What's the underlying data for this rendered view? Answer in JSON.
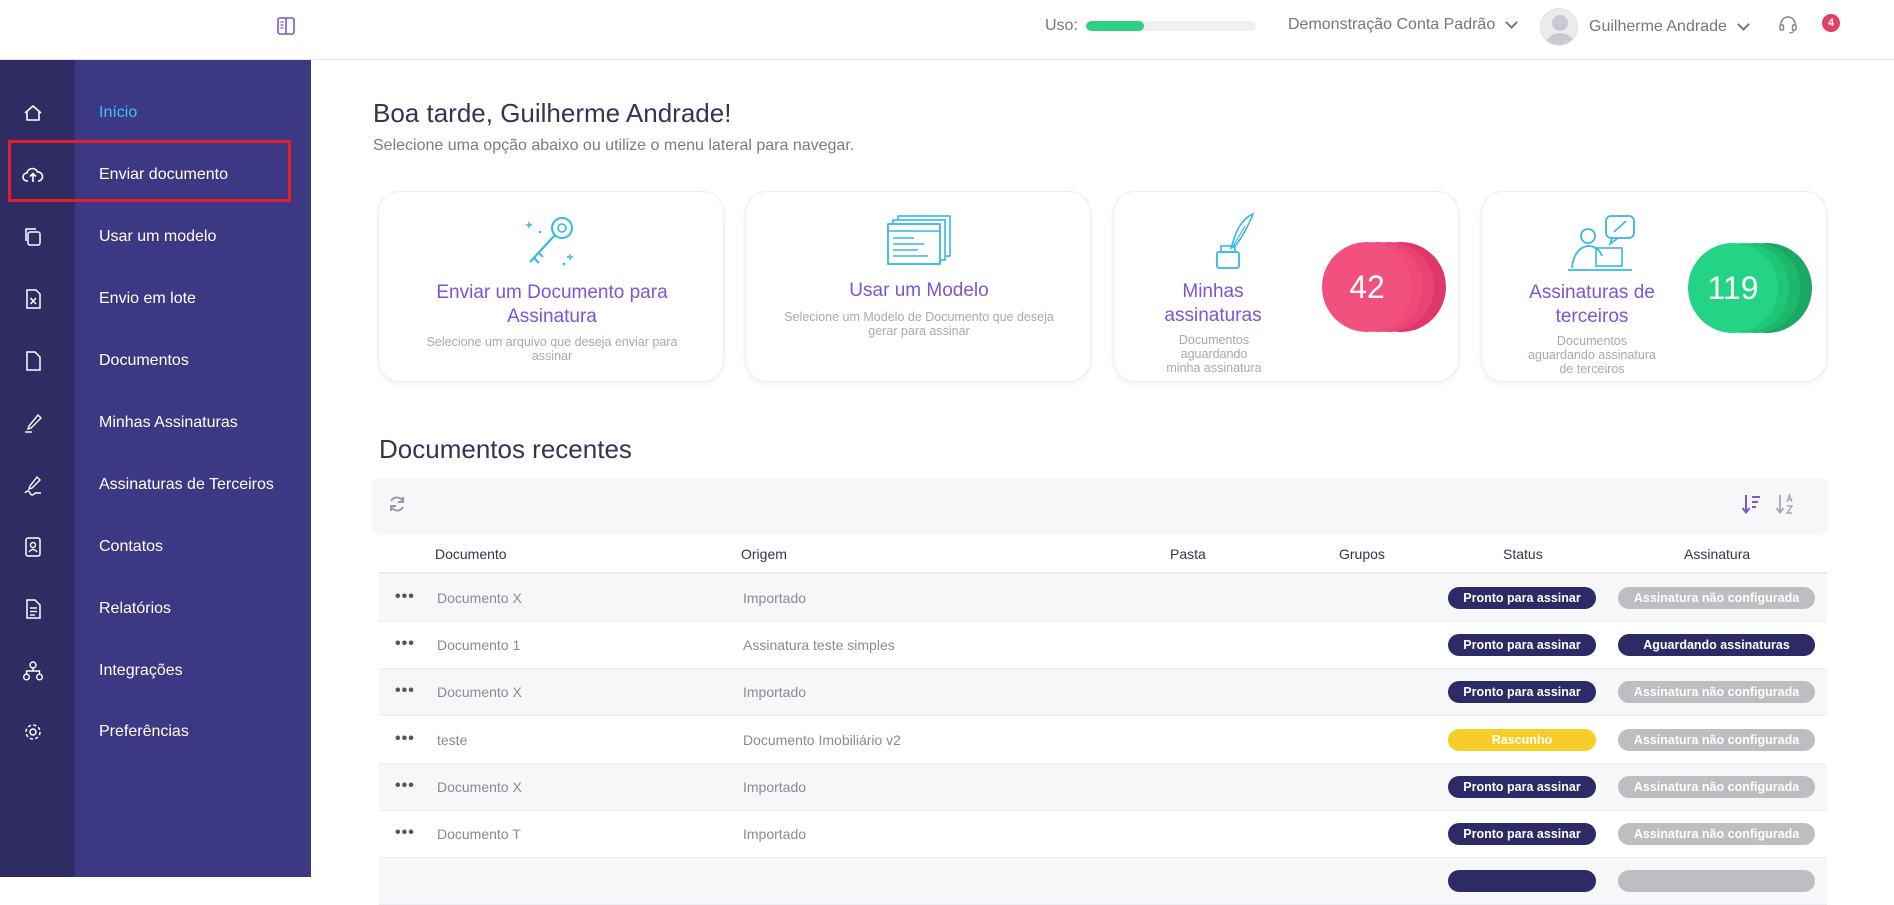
{
  "header": {
    "usage_label": "Uso:",
    "usage_fraction": 0.34,
    "account_name": "Demonstração Conta Padrão",
    "user_name": "Guilherme Andrade",
    "notification_count": "4"
  },
  "sidebar": {
    "items": [
      {
        "label": "Início",
        "icon": "home-icon",
        "active": true
      },
      {
        "label": "Enviar documento",
        "icon": "cloud-upload-icon",
        "active": false
      },
      {
        "label": "Usar um modelo",
        "icon": "template-icon",
        "active": false
      },
      {
        "label": "Envio em lote",
        "icon": "spreadsheet-icon",
        "active": false
      },
      {
        "label": "Documentos",
        "icon": "document-icon",
        "active": false
      },
      {
        "label": "Minhas Assinaturas",
        "icon": "pen-icon",
        "active": false
      },
      {
        "label": "Assinaturas de Terceiros",
        "icon": "signature-icon",
        "active": false
      },
      {
        "label": "Contatos",
        "icon": "contact-icon",
        "active": false
      },
      {
        "label": "Relatórios",
        "icon": "report-icon",
        "active": false
      },
      {
        "label": "Integrações",
        "icon": "integration-icon",
        "active": false
      },
      {
        "label": "Preferências",
        "icon": "gear-icon",
        "active": false
      }
    ]
  },
  "main": {
    "greeting": "Boa tarde, Guilherme Andrade!",
    "subtitle": "Selecione uma opção abaixo ou utilize o menu lateral para navegar."
  },
  "cards": [
    {
      "title": "Enviar um Documento para Assinatura",
      "desc": "Selecione um arquivo que deseja enviar para assinar"
    },
    {
      "title": "Usar um Modelo",
      "desc": "Selecione um Modelo de Documento que deseja gerar para assinar"
    },
    {
      "title": "Minhas assinaturas",
      "desc": "Documentos aguardando minha assinatura",
      "count": "42"
    },
    {
      "title": "Assinaturas de terceiros",
      "desc": "Documentos aguardando assinatura de terceiros",
      "count": "119"
    }
  ],
  "recent": {
    "title": "Documentos recentes",
    "columns": [
      "Documento",
      "Origem",
      "Pasta",
      "Grupos",
      "Status",
      "Assinatura"
    ],
    "rows": [
      {
        "doc": "Documento X",
        "origin": "Importado",
        "status": "Pronto para assinar",
        "sign": "Assinatura não configurada"
      },
      {
        "doc": "Documento 1",
        "origin": "Assinatura teste simples",
        "status": "Pronto para assinar",
        "sign": "Aguardando assinaturas"
      },
      {
        "doc": "Documento X",
        "origin": "Importado",
        "status": "Pronto para assinar",
        "sign": "Assinatura não configurada"
      },
      {
        "doc": "teste",
        "origin": "Documento Imobiliário v2",
        "status": "Rascunho",
        "sign": "Assinatura não configurada"
      },
      {
        "doc": "Documento X",
        "origin": "Importado",
        "status": "Pronto para assinar",
        "sign": "Assinatura não configurada"
      },
      {
        "doc": "Documento T",
        "origin": "Importado",
        "status": "Pronto para assinar",
        "sign": "Assinatura não configurada"
      }
    ]
  },
  "colors": {
    "rail": "#2f2c63",
    "menu": "#3c3884",
    "accent_purple": "#7d54d8",
    "accent_cyan": "#3fc3ec",
    "pink": "#f2507e",
    "green": "#25d385",
    "navy_badge": "#2d2a68",
    "yellow_badge": "#f7ce29",
    "gray_badge": "#bdbdc2"
  }
}
